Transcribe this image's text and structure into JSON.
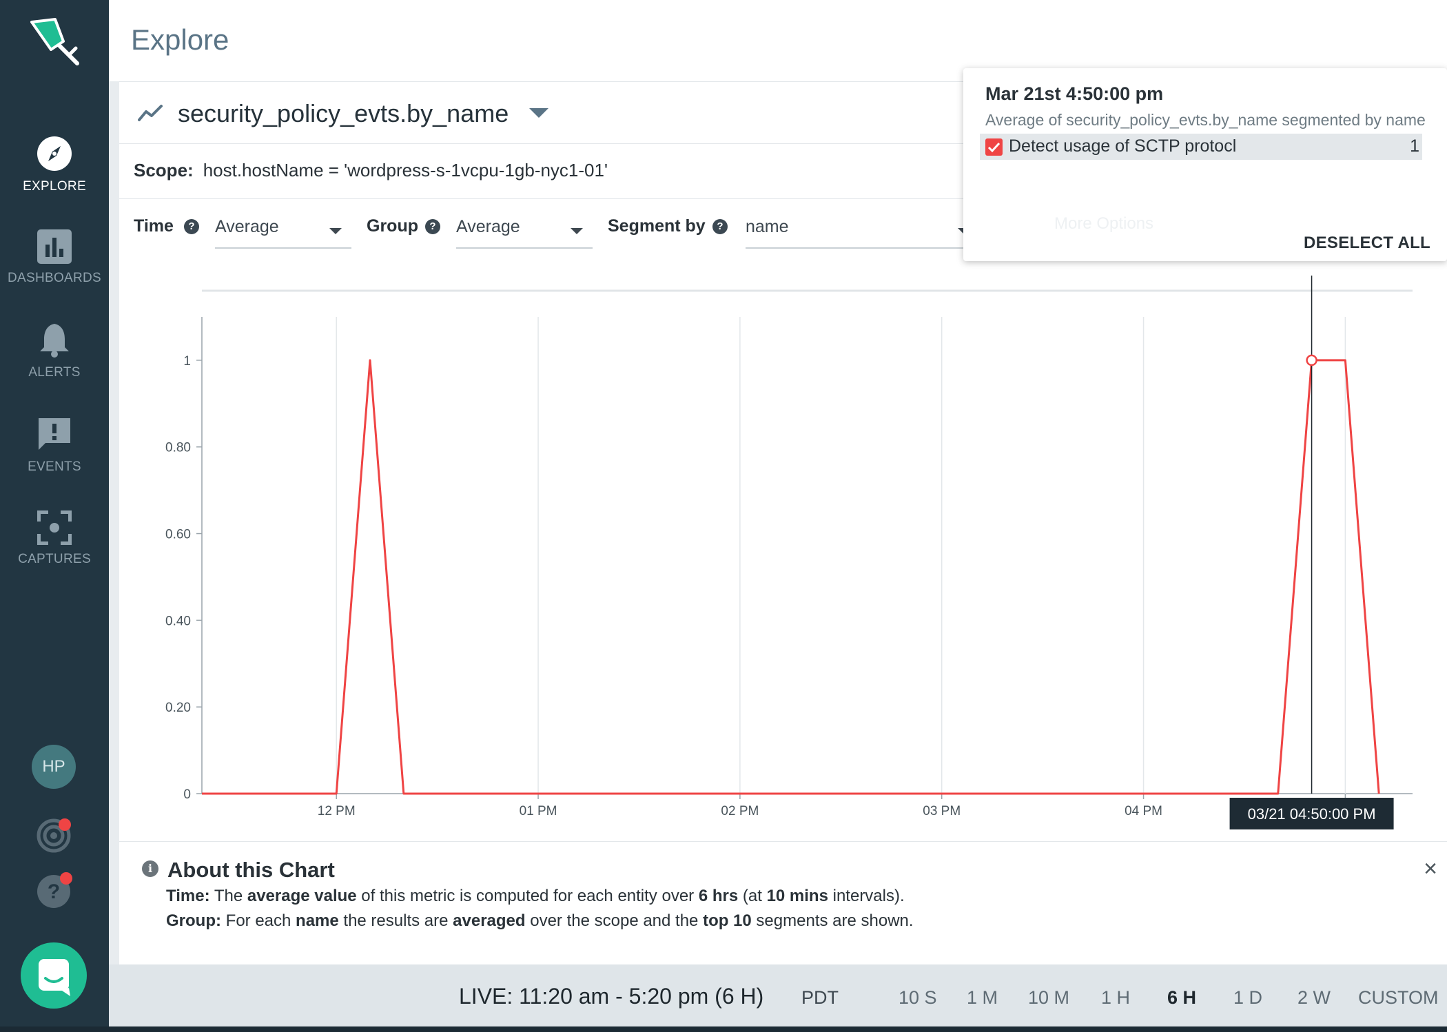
{
  "sidebar": {
    "items": [
      {
        "label": "EXPLORE",
        "icon": "compass-icon",
        "active": true
      },
      {
        "label": "DASHBOARDS",
        "icon": "bar-chart-icon",
        "active": false
      },
      {
        "label": "ALERTS",
        "icon": "bell-icon",
        "active": false
      },
      {
        "label": "EVENTS",
        "icon": "message-alert-icon",
        "active": false
      },
      {
        "label": "CAPTURES",
        "icon": "capture-icon",
        "active": false
      }
    ],
    "avatar": "HP"
  },
  "page": {
    "title": "Explore"
  },
  "metric": {
    "name": "security_policy_evts.by_name"
  },
  "scope": {
    "label": "Scope:",
    "value": "host.hostName = 'wordpress-s-1vcpu-1gb-nyc1-01'"
  },
  "controls": {
    "time_label": "Time",
    "time_value": "Average",
    "group_label": "Group",
    "group_value": "Average",
    "segment_label": "Segment by",
    "segment_value": "name"
  },
  "tooltip": {
    "time": "Mar 21st 4:50:00 pm",
    "subtitle": "Average of security_policy_evts.by_name segmented by name",
    "segment": "Detect usage of SCTP protocl",
    "value": "1",
    "ghost_option": "More Options",
    "deselect": "DESELECT ALL"
  },
  "chart_data": {
    "type": "line",
    "x_ticks": [
      "12 PM",
      "01 PM",
      "02 PM",
      "03 PM",
      "04 PM"
    ],
    "y_ticks": [
      "0",
      "0.20",
      "0.40",
      "0.60",
      "0.80",
      "1"
    ],
    "ylim": [
      0,
      1.1
    ],
    "series": [
      {
        "name": "Detect usage of SCTP protocl",
        "color": "#ef4444",
        "x": [
          "11:20",
          "11:30",
          "11:40",
          "11:50",
          "12:00",
          "12:10",
          "12:20",
          "12:30",
          "12:40",
          "12:50",
          "13:00",
          "13:10",
          "13:20",
          "13:30",
          "13:40",
          "13:50",
          "14:00",
          "14:10",
          "14:20",
          "14:30",
          "14:40",
          "14:50",
          "15:00",
          "15:10",
          "15:20",
          "15:30",
          "15:40",
          "15:50",
          "16:00",
          "16:10",
          "16:20",
          "16:30",
          "16:40",
          "16:50",
          "17:00",
          "17:10"
        ],
        "values": [
          0,
          0,
          0,
          0,
          0,
          1,
          0,
          0,
          0,
          0,
          0,
          0,
          0,
          0,
          0,
          0,
          0,
          0,
          0,
          0,
          0,
          0,
          0,
          0,
          0,
          0,
          0,
          0,
          0,
          0,
          0,
          0,
          0,
          1,
          1,
          0
        ]
      }
    ],
    "hover": {
      "label": "03/21 04:50:00 PM",
      "x": "16:50",
      "value": 1
    }
  },
  "about": {
    "title": "About this Chart",
    "time_line": {
      "label": "Time:",
      "t1": " The ",
      "b1": "average value",
      "t2": " of this metric is computed for each entity over ",
      "b2": "6 hrs",
      "t3": " (at ",
      "b3": "10 mins",
      "t4": " intervals)."
    },
    "group_line": {
      "label": "Group:",
      "t1": " For each ",
      "b1": "name",
      "t2": " the results are ",
      "b2": "averaged",
      "t3": " over the scope and the ",
      "b3": "top 10",
      "t4": " segments are shown."
    }
  },
  "footer": {
    "live": "LIVE: 11:20 am - 5:20 pm (6 H)",
    "timezone": "PDT",
    "ranges": [
      {
        "label": "10 S",
        "active": false
      },
      {
        "label": "1 M",
        "active": false
      },
      {
        "label": "10 M",
        "active": false
      },
      {
        "label": "1 H",
        "active": false
      },
      {
        "label": "6 H",
        "active": true
      },
      {
        "label": "1 D",
        "active": false
      },
      {
        "label": "2 W",
        "active": false
      },
      {
        "label": "CUSTOM",
        "active": false
      }
    ]
  },
  "colors": {
    "sidebar": "#223642",
    "accent": "#1fbd93",
    "series": "#ef4444",
    "footer": "#dfe5e9"
  }
}
